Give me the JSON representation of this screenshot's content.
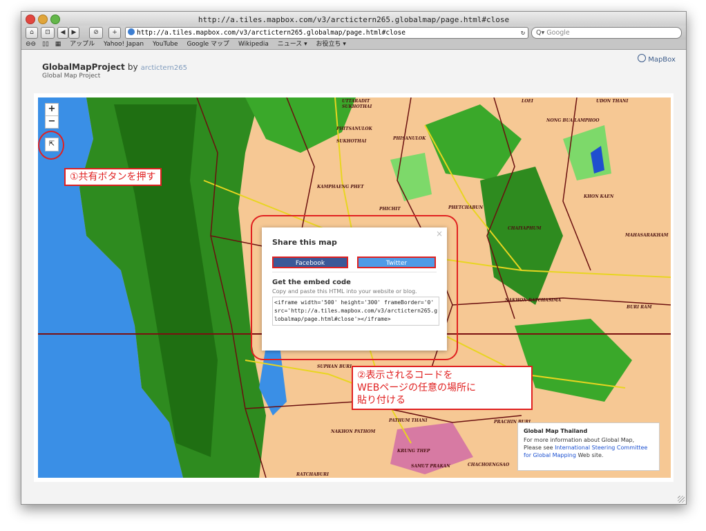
{
  "window": {
    "title": "http://a.tiles.mapbox.com/v3/arctictern265.globalmap/page.html#close"
  },
  "toolbar": {
    "url": "http://a.tiles.mapbox.com/v3/arctictern265.globalmap/page.html#close",
    "search_placeholder": "Google",
    "buttons": [
      "⌂",
      "⊡",
      "◀",
      "▶",
      "⊘",
      "+"
    ]
  },
  "bookmarks": [
    "アップル",
    "Yahoo! Japan",
    "YouTube",
    "Google マップ",
    "Wikipedia",
    "ニュース ▾",
    "お役立ち ▾"
  ],
  "site": {
    "title": "GlobalMapProject",
    "by": "by",
    "author": "arctictern265",
    "subtitle": "Global Map Project",
    "mapbox_label": "MapBox"
  },
  "map_controls": {
    "zoom_in": "+",
    "zoom_out": "−",
    "share_icon": "share-icon"
  },
  "annotations": {
    "step1": "①共有ボタンを押す",
    "step2": "②表示されるコードを\nWEBページの任意の場所に\n貼り付ける"
  },
  "share_modal": {
    "title": "Share this map",
    "close": "×",
    "facebook": "Facebook",
    "twitter": "Twitter",
    "embed_title": "Get the embed code",
    "embed_hint": "Copy and paste this HTML into your website or blog.",
    "embed_code": "<iframe width='500' height='300' frameBorder='0' src='http://a.tiles.mapbox.com/v3/arctictern265.globalmap/page.html#close'></iframe>"
  },
  "attribution": {
    "title": "Global Map Thailand",
    "text_before": "For more information about Global Map, Please see",
    "link": "International Steering Committee for Global Mapping",
    "text_after": "Web site."
  },
  "map_labels": [
    "UTTARADIT",
    "SUKHOTHAI",
    "PHITSANULOK",
    "SUKHOTHAI",
    "PHISANULOK",
    "LOEI",
    "UDON THANI",
    "NONG BUA LAMPHOO",
    "KAMPHAENG PHET",
    "PHICHIT",
    "PHETCHABUN",
    "KHON KAEN",
    "CHAIYAPHUM",
    "MAHASARAKHAM",
    "NAKHON RATCHASIMA",
    "BURI RAM",
    "SUPHAN BURI",
    "PATHUM THANI",
    "NAKHON PATHOM",
    "KRUNG THEP",
    "SAMUT PRAKAN",
    "CHACHOENGSAO",
    "PRACHIN BURI",
    "RATCHABURI"
  ],
  "colors": {
    "red_annotation": "#e02020",
    "facebook": "#3b5998",
    "twitter": "#4f9be6",
    "land": "#f6c894",
    "forest": "#2e8b1f",
    "water": "#3a8fe6"
  }
}
